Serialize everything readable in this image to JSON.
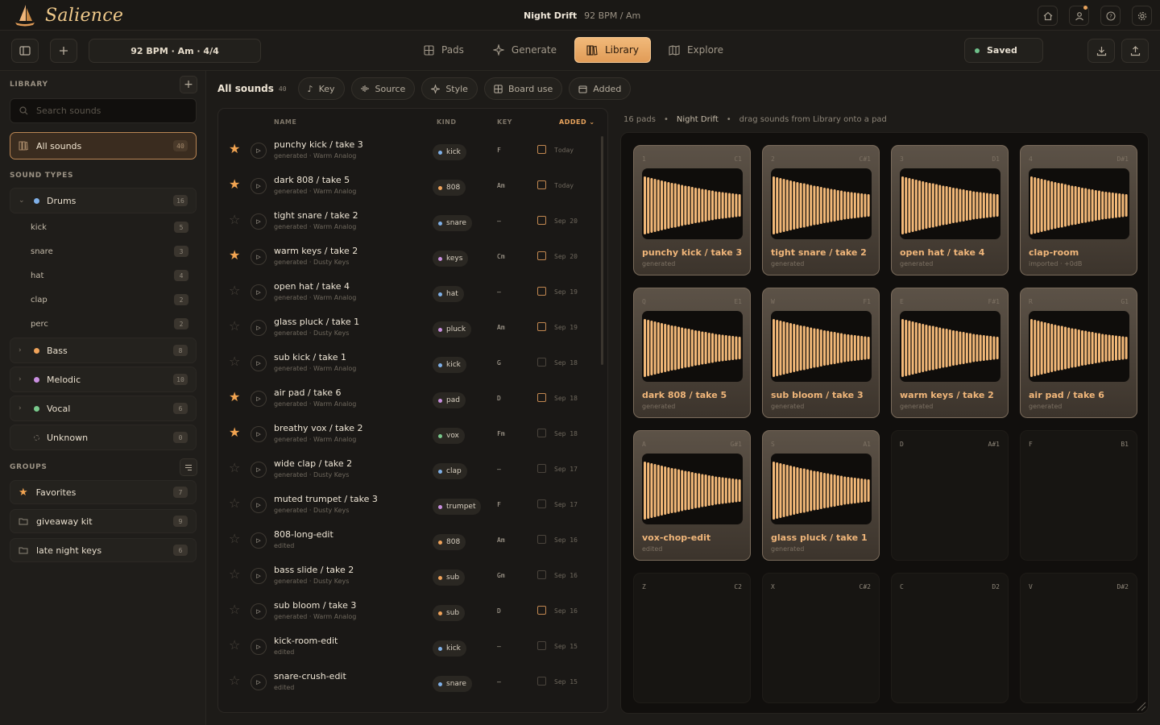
{
  "app": {
    "brand": "Salience",
    "project_name": "Night Drift",
    "project_meta": "92 BPM  /  Am"
  },
  "toolbar": {
    "tempo_label": "92 BPM · Am · 4/4",
    "tabs": [
      {
        "label": "Pads",
        "icon": "grid-icon",
        "active": false
      },
      {
        "label": "Generate",
        "icon": "sparkle-icon",
        "active": false
      },
      {
        "label": "Library",
        "icon": "library-icon",
        "active": true
      },
      {
        "label": "Explore",
        "icon": "map-icon",
        "active": false
      }
    ],
    "saved_label": "Saved"
  },
  "sidebar": {
    "library_label": "LIBRARY",
    "search_placeholder": "Search sounds",
    "all_sounds": {
      "label": "All sounds",
      "count": "40"
    },
    "sound_types_label": "SOUND TYPES",
    "drums": {
      "label": "Drums",
      "count": "16",
      "color": "#7fb0e8"
    },
    "drum_items": [
      {
        "label": "kick",
        "count": "5"
      },
      {
        "label": "snare",
        "count": "3"
      },
      {
        "label": "hat",
        "count": "4"
      },
      {
        "label": "clap",
        "count": "2"
      },
      {
        "label": "perc",
        "count": "2"
      }
    ],
    "categories": [
      {
        "label": "Bass",
        "count": "8",
        "color": "#f0a35a"
      },
      {
        "label": "Melodic",
        "count": "10",
        "color": "#c98fe0"
      },
      {
        "label": "Vocal",
        "count": "6",
        "color": "#79c98c"
      },
      {
        "label": "Unknown",
        "count": "0",
        "color": "#6b655c"
      }
    ],
    "groups_label": "GROUPS",
    "groups": [
      {
        "label": "Favorites",
        "count": "7",
        "icon": "star-icon"
      },
      {
        "label": "giveaway kit",
        "count": "9",
        "icon": "folder-icon"
      },
      {
        "label": "late night keys",
        "count": "6",
        "icon": "folder-icon"
      }
    ]
  },
  "filters": {
    "title": "All sounds",
    "count": "40",
    "chips": [
      {
        "label": "Key",
        "icon": "music-note-icon"
      },
      {
        "label": "Source",
        "icon": "waveform-icon"
      },
      {
        "label": "Style",
        "icon": "sparkle-icon"
      },
      {
        "label": "Board use",
        "icon": "grid-icon"
      },
      {
        "label": "Added",
        "icon": "calendar-icon"
      }
    ]
  },
  "list": {
    "headers": {
      "name": "NAME",
      "kind": "KIND",
      "key": "KEY",
      "added": "ADDED"
    },
    "rows": [
      {
        "name": "punchy kick / take 3",
        "sub": "generated · Warm Analog",
        "kind": "kick",
        "kind_color": "#7fb0e8",
        "key": "F",
        "on_board": true,
        "added": "Today",
        "fav": true
      },
      {
        "name": "dark 808 / take 5",
        "sub": "generated · Warm Analog",
        "kind": "808",
        "kind_color": "#f0a35a",
        "key": "Am",
        "on_board": true,
        "added": "Today",
        "fav": true
      },
      {
        "name": "tight snare / take 2",
        "sub": "generated · Warm Analog",
        "kind": "snare",
        "kind_color": "#7fb0e8",
        "key": "—",
        "on_board": true,
        "added": "Sep 20",
        "fav": false
      },
      {
        "name": "warm keys / take 2",
        "sub": "generated · Dusty Keys",
        "kind": "keys",
        "kind_color": "#c98fe0",
        "key": "Cm",
        "on_board": true,
        "added": "Sep 20",
        "fav": true
      },
      {
        "name": "open hat / take 4",
        "sub": "generated · Warm Analog",
        "kind": "hat",
        "kind_color": "#7fb0e8",
        "key": "—",
        "on_board": true,
        "added": "Sep 19",
        "fav": false
      },
      {
        "name": "glass pluck / take 1",
        "sub": "generated · Dusty Keys",
        "kind": "pluck",
        "kind_color": "#c98fe0",
        "key": "Am",
        "on_board": true,
        "added": "Sep 19",
        "fav": false
      },
      {
        "name": "sub kick / take 1",
        "sub": "generated · Warm Analog",
        "kind": "kick",
        "kind_color": "#7fb0e8",
        "key": "G",
        "on_board": false,
        "added": "Sep 18",
        "fav": false
      },
      {
        "name": "air pad / take 6",
        "sub": "generated · Warm Analog",
        "kind": "pad",
        "kind_color": "#c98fe0",
        "key": "D",
        "on_board": true,
        "added": "Sep 18",
        "fav": true
      },
      {
        "name": "breathy vox / take 2",
        "sub": "generated · Warm Analog",
        "kind": "vox",
        "kind_color": "#79c98c",
        "key": "Fm",
        "on_board": false,
        "added": "Sep 18",
        "fav": true
      },
      {
        "name": "wide clap / take 2",
        "sub": "generated · Dusty Keys",
        "kind": "clap",
        "kind_color": "#7fb0e8",
        "key": "—",
        "on_board": false,
        "added": "Sep 17",
        "fav": false
      },
      {
        "name": "muted trumpet / take 3",
        "sub": "generated · Dusty Keys",
        "kind": "trumpet",
        "kind_color": "#c98fe0",
        "key": "F",
        "on_board": false,
        "added": "Sep 17",
        "fav": false
      },
      {
        "name": "808-long-edit",
        "sub": "edited",
        "kind": "808",
        "kind_color": "#f0a35a",
        "key": "Am",
        "on_board": false,
        "added": "Sep 16",
        "fav": false
      },
      {
        "name": "bass slide / take 2",
        "sub": "generated · Dusty Keys",
        "kind": "sub",
        "kind_color": "#f0a35a",
        "key": "Gm",
        "on_board": false,
        "added": "Sep 16",
        "fav": false
      },
      {
        "name": "sub bloom / take 3",
        "sub": "generated · Warm Analog",
        "kind": "sub",
        "kind_color": "#f0a35a",
        "key": "D",
        "on_board": true,
        "added": "Sep 16",
        "fav": false
      },
      {
        "name": "kick-room-edit",
        "sub": "edited",
        "kind": "kick",
        "kind_color": "#7fb0e8",
        "key": "—",
        "on_board": false,
        "added": "Sep 15",
        "fav": false
      },
      {
        "name": "snare-crush-edit",
        "sub": "edited",
        "kind": "snare",
        "kind_color": "#7fb0e8",
        "key": "—",
        "on_board": false,
        "added": "Sep 15",
        "fav": false
      }
    ]
  },
  "board": {
    "pad_count": "16 pads",
    "project": "Night Drift",
    "hint": "drag sounds from Library onto a pad",
    "pads": [
      {
        "key": "1",
        "note": "C1",
        "name": "punchy kick / take 3",
        "sub": "generated"
      },
      {
        "key": "2",
        "note": "C#1",
        "name": "tight snare / take 2",
        "sub": "generated"
      },
      {
        "key": "3",
        "note": "D1",
        "name": "open hat / take 4",
        "sub": "generated"
      },
      {
        "key": "4",
        "note": "D#1",
        "name": "clap-room",
        "sub": "imported · +0dB"
      },
      {
        "key": "Q",
        "note": "E1",
        "name": "dark 808 / take 5",
        "sub": "generated"
      },
      {
        "key": "W",
        "note": "F1",
        "name": "sub bloom / take 3",
        "sub": "generated"
      },
      {
        "key": "E",
        "note": "F#1",
        "name": "warm keys / take 2",
        "sub": "generated"
      },
      {
        "key": "R",
        "note": "G1",
        "name": "air pad / take 6",
        "sub": "generated"
      },
      {
        "key": "A",
        "note": "G#1",
        "name": "vox-chop-edit",
        "sub": "edited"
      },
      {
        "key": "S",
        "note": "A1",
        "name": "glass pluck / take 1",
        "sub": "generated"
      },
      {
        "key": "D",
        "note": "A#1",
        "name": "",
        "sub": ""
      },
      {
        "key": "F",
        "note": "B1",
        "name": "",
        "sub": ""
      },
      {
        "key": "Z",
        "note": "C2",
        "name": "",
        "sub": ""
      },
      {
        "key": "X",
        "note": "C#2",
        "name": "",
        "sub": ""
      },
      {
        "key": "C",
        "note": "D2",
        "name": "",
        "sub": ""
      },
      {
        "key": "V",
        "note": "D#2",
        "name": "",
        "sub": ""
      }
    ]
  }
}
